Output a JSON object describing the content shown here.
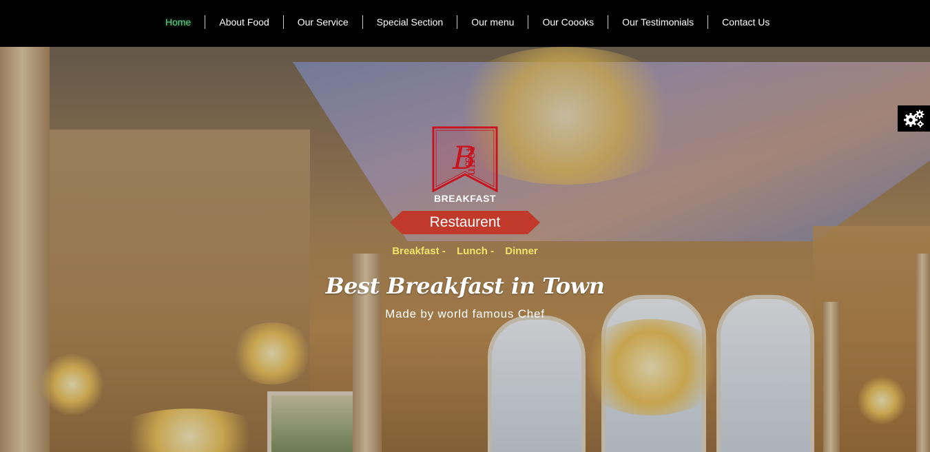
{
  "nav": {
    "items": [
      {
        "label": "Home",
        "active": true
      },
      {
        "label": "About Food"
      },
      {
        "label": "Our Service"
      },
      {
        "label": "Special Section"
      },
      {
        "label": "Our menu"
      },
      {
        "label": "Our Coooks"
      },
      {
        "label": "Our Testimonials"
      },
      {
        "label": "Contact Us"
      }
    ]
  },
  "hero": {
    "logo_letter": "B",
    "logo_side_text": "uffet",
    "logo_caption": "BREAKFAST",
    "ribbon_label": "Restaurent",
    "meals": [
      "Breakfast -",
      "Lunch -",
      "Dinner"
    ],
    "headline": "Best Breakfast in Town",
    "subline": "Made by world famous Chef"
  },
  "settings": {
    "icon": "gears-icon"
  },
  "colors": {
    "nav_bg": "#000000",
    "active_link": "#5fd48a",
    "ribbon": "#c0392b",
    "meals_text": "#f0e36a",
    "logo_red": "#c8141e"
  }
}
